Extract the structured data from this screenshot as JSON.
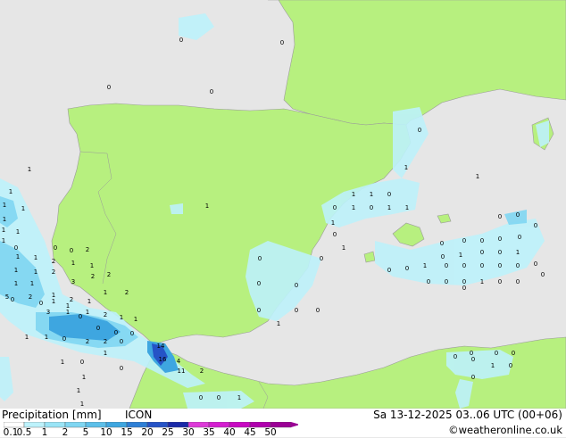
{
  "title": "Precipitation [mm]",
  "model": "ICON",
  "datetime": "Sa 13-12-2025 03..06 UTC (00+06)",
  "credit": "©weatheronline.co.uk",
  "legend": {
    "labels": [
      "0.1",
      "0.5",
      "1",
      "2",
      "5",
      "10",
      "15",
      "20",
      "25",
      "30",
      "35",
      "40",
      "45",
      "50"
    ],
    "colors": [
      "#ffffff",
      "#bdf2fb",
      "#9ae4f6",
      "#7fd6f2",
      "#5cbfe9",
      "#3ea6e0",
      "#2d7fd6",
      "#2553c6",
      "#1a2aa8",
      "#dd3ad8",
      "#d41ed0",
      "#c809c2",
      "#b000ae",
      "#9b0095"
    ]
  },
  "land_colors": {
    "spain_africa": "#b7f07f",
    "france_and_other": "#b7f07f",
    "sea": "#e6e6e6"
  },
  "precip_values": [
    "0",
    "0",
    "0",
    "0",
    "0",
    "1",
    "1",
    "1",
    "1",
    "1",
    "1",
    "1",
    "1",
    "1",
    "0",
    "0",
    "0",
    "2",
    "1",
    "1",
    "2",
    "1",
    "1",
    "1",
    "1",
    "2",
    "1",
    "1",
    "3",
    "2",
    "2",
    "5",
    "2",
    "1",
    "2",
    "1",
    "1",
    "2",
    "3",
    "1",
    "1",
    "2",
    "1",
    "1",
    "14",
    "16",
    "4",
    "11",
    "2",
    "1",
    "1",
    "0",
    "2",
    "2",
    "0",
    "1",
    "0",
    "1",
    "0",
    "1",
    "1",
    "1",
    "1",
    "0",
    "0",
    "0",
    "0",
    "0",
    "0",
    "1",
    "0",
    "0",
    "0",
    "1",
    "1",
    "0",
    "1",
    "0",
    "1",
    "1",
    "1",
    "1",
    "0",
    "0",
    "1",
    "0",
    "1",
    "0",
    "0",
    "1",
    "0",
    "0",
    "0",
    "0",
    "0",
    "0",
    "0",
    "0",
    "0",
    "1",
    "0",
    "0",
    "0",
    "0",
    "0",
    "0",
    "0",
    "0",
    "0",
    "0",
    "0",
    "0",
    "1",
    "0",
    "1",
    "0",
    "0",
    "0",
    "0",
    "0",
    "0",
    "0",
    "0",
    "1",
    "0",
    "0",
    "1",
    "1",
    "0",
    "0",
    "0",
    "0"
  ]
}
